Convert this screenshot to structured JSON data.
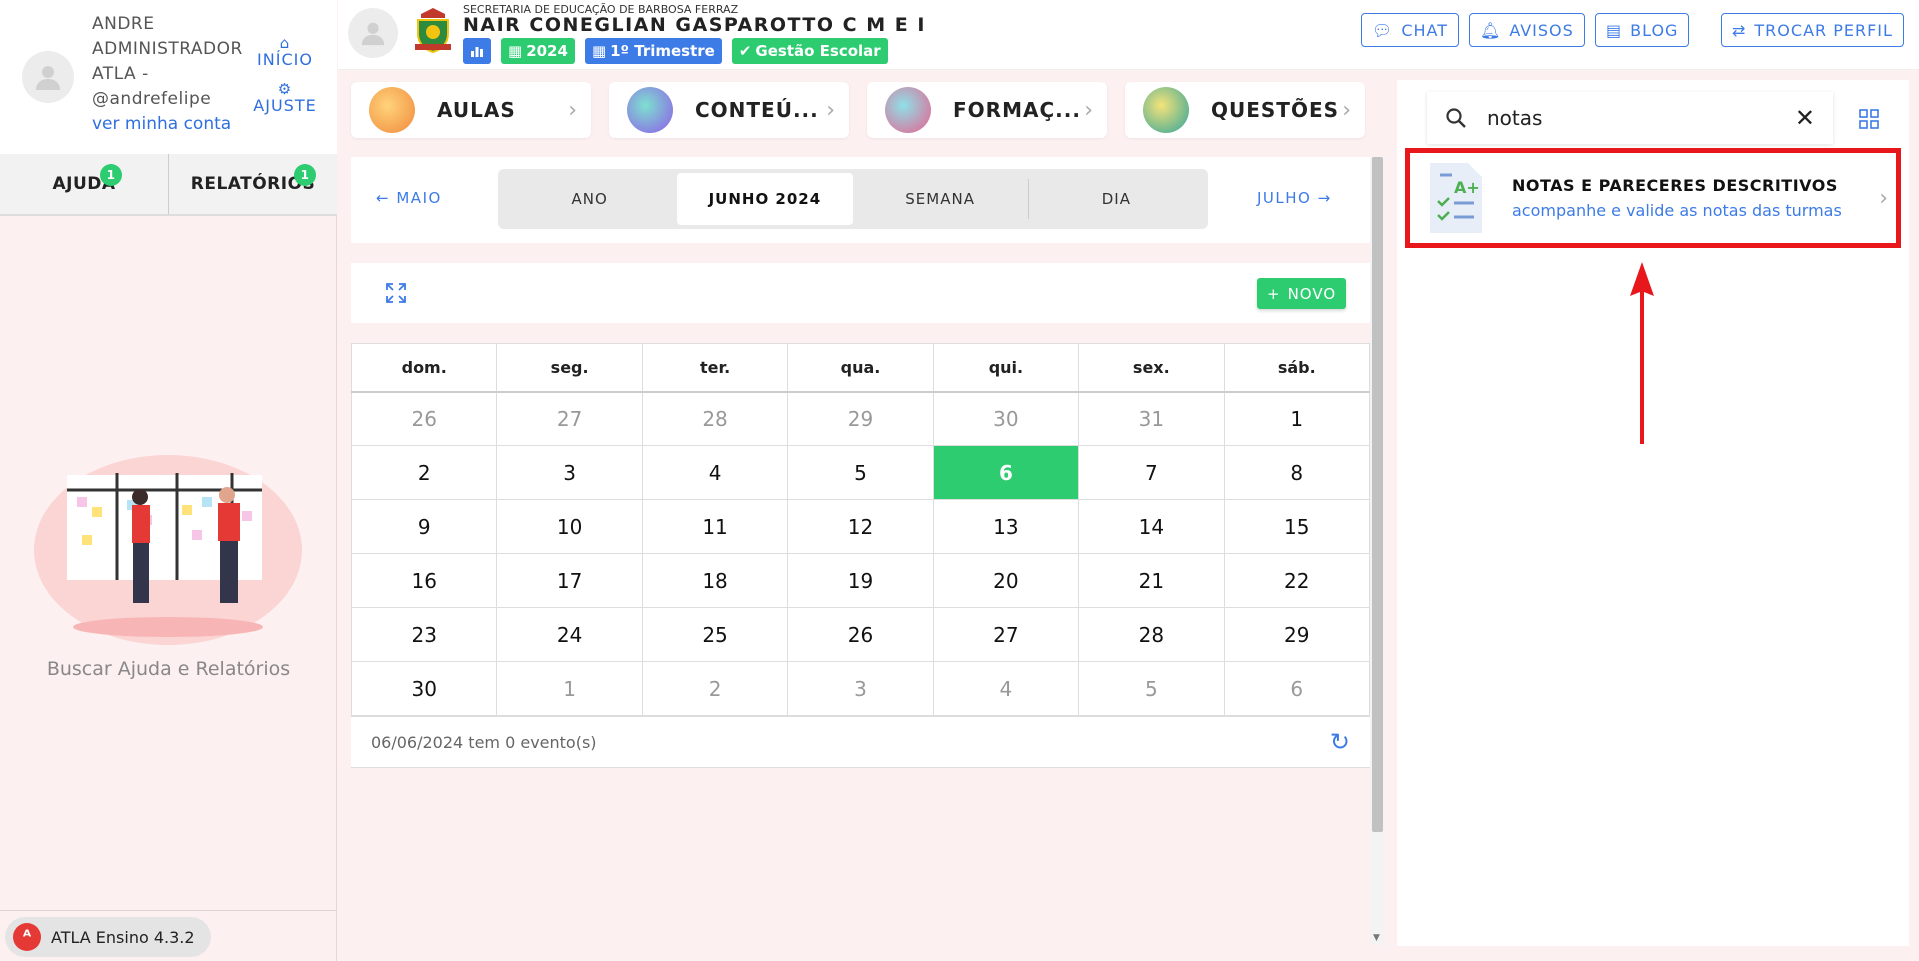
{
  "profile": {
    "name": "ANDRE ADMINISTRADOR ATLA - @andrefelipe",
    "account_link": "ver minha conta",
    "nav_home": "INÍCIO",
    "nav_settings": "AJUSTE"
  },
  "sidebar": {
    "tabs": [
      {
        "label": "AJUDA",
        "badge": "1"
      },
      {
        "label": "RELATÓRIOS",
        "badge": "1"
      }
    ],
    "help_caption": "Buscar Ajuda e Relatórios",
    "version": "ATLA Ensino 4.3.2"
  },
  "header": {
    "secretaria": "SECRETARIA DE EDUCAÇÃO DE BARBOSA FERRAZ",
    "school": "NAIR CONEGLIAN GASPAROTTO C M E I",
    "chip_year": "2024",
    "chip_term": "1º Trimestre",
    "chip_mgmt": "Gestão Escolar",
    "buttons": {
      "chat": "CHAT",
      "avisos": "AVISOS",
      "blog": "BLOG",
      "trocar": "TROCAR PERFIL"
    }
  },
  "features": [
    {
      "label": "AULAS",
      "icon": "lessons-icon",
      "color": "#f08a3c"
    },
    {
      "label": "CONTEÚ...",
      "icon": "content-icon",
      "color": "#8e5be8"
    },
    {
      "label": "FORMAÇ...",
      "icon": "training-icon",
      "color": "#e8608e"
    },
    {
      "label": "QUESTÕES",
      "icon": "questions-icon",
      "color": "#2fa39a"
    }
  ],
  "calendar": {
    "prev": "MAIO",
    "next": "JULHO",
    "views": [
      "ANO",
      "JUNHO 2024",
      "SEMANA",
      "DIA"
    ],
    "active_view": "JUNHO 2024",
    "new_button": "NOVO",
    "weekdays": [
      "dom.",
      "seg.",
      "ter.",
      "qua.",
      "qui.",
      "sex.",
      "sáb."
    ],
    "weeks": [
      [
        [
          "26",
          "other"
        ],
        [
          "27",
          "other"
        ],
        [
          "28",
          "other"
        ],
        [
          "29",
          "other"
        ],
        [
          "30",
          "other"
        ],
        [
          "31",
          "other"
        ],
        [
          "1",
          ""
        ]
      ],
      [
        [
          "2",
          ""
        ],
        [
          "3",
          ""
        ],
        [
          "4",
          ""
        ],
        [
          "5",
          ""
        ],
        [
          "6",
          "today"
        ],
        [
          "7",
          ""
        ],
        [
          "8",
          ""
        ]
      ],
      [
        [
          "9",
          ""
        ],
        [
          "10",
          ""
        ],
        [
          "11",
          ""
        ],
        [
          "12",
          ""
        ],
        [
          "13",
          ""
        ],
        [
          "14",
          ""
        ],
        [
          "15",
          ""
        ]
      ],
      [
        [
          "16",
          ""
        ],
        [
          "17",
          ""
        ],
        [
          "18",
          ""
        ],
        [
          "19",
          ""
        ],
        [
          "20",
          ""
        ],
        [
          "21",
          ""
        ],
        [
          "22",
          ""
        ]
      ],
      [
        [
          "23",
          ""
        ],
        [
          "24",
          ""
        ],
        [
          "25",
          ""
        ],
        [
          "26",
          ""
        ],
        [
          "27",
          ""
        ],
        [
          "28",
          ""
        ],
        [
          "29",
          ""
        ]
      ],
      [
        [
          "30",
          ""
        ],
        [
          "1",
          "other"
        ],
        [
          "2",
          "other"
        ],
        [
          "3",
          "other"
        ],
        [
          "4",
          "other"
        ],
        [
          "5",
          "other"
        ],
        [
          "6",
          "other"
        ]
      ]
    ],
    "events_summary": "06/06/2024 tem 0 evento(s)"
  },
  "search": {
    "value": "notas",
    "result_title": "NOTAS E PARECERES DESCRITIVOS",
    "result_subtitle": "acompanhe e valide as notas das turmas"
  },
  "colors": {
    "accent": "#3d7be6",
    "success": "#2ecc71",
    "highlight": "#e8171b"
  }
}
